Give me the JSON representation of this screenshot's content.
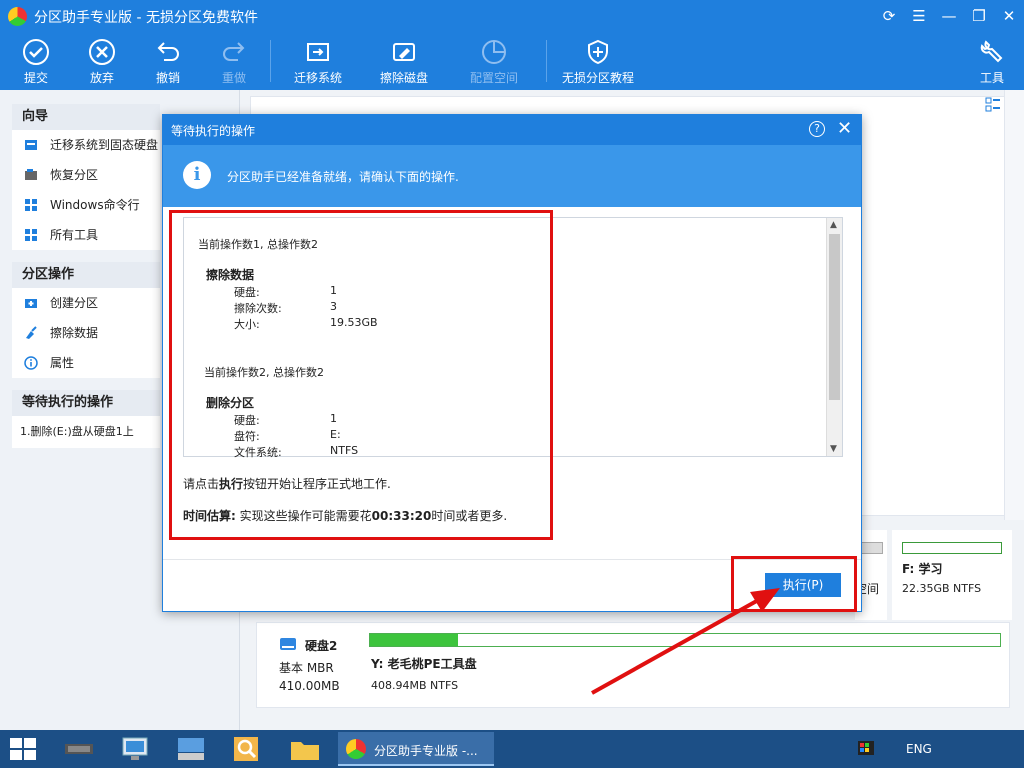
{
  "window": {
    "title": "分区助手专业版 - 无损分区免费软件"
  },
  "toolbar": {
    "commit": "提交",
    "discard": "放弃",
    "undo": "撤销",
    "redo": "重做",
    "migrate": "迁移系统",
    "wipe": "擦除磁盘",
    "config": "配置空间",
    "tutorial": "无损分区教程",
    "tools": "工具"
  },
  "sidebar": {
    "wizard": {
      "title": "向导",
      "items": [
        "迁移系统到固态硬盘",
        "恢复分区",
        "Windows命令行",
        "所有工具"
      ]
    },
    "partition_ops": {
      "title": "分区操作",
      "items": [
        "创建分区",
        "擦除数据",
        "属性"
      ]
    },
    "pending": {
      "title": "等待执行的操作",
      "item": "1.删除(E:)盘从硬盘1上"
    }
  },
  "dialog": {
    "title": "等待执行的操作",
    "help": "?",
    "info_message": "分区助手已经准备就绪，请确认下面的操作.",
    "op1": {
      "header": "当前操作数1, 总操作数2",
      "name": "擦除数据",
      "rows": [
        [
          "硬盘:",
          "1"
        ],
        [
          "擦除次数:",
          "3"
        ],
        [
          "大小:",
          "19.53GB"
        ]
      ]
    },
    "op2": {
      "header": "当前操作数2, 总操作数2",
      "name": "删除分区",
      "rows": [
        [
          "硬盘:",
          "1"
        ],
        [
          "盘符:",
          "E:"
        ],
        [
          "文件系统:",
          "NTFS"
        ]
      ]
    },
    "note_pre": "请点击",
    "note_bold": "执行",
    "note_post": "按钮开始让程序正式地工作.",
    "estimate_label": "时间估算:",
    "estimate_pre": " 实现这些操作可能需要花",
    "estimate_time": "00:33:20",
    "estimate_post": "时间或者更多.",
    "execute_button": "执行(P)"
  },
  "disk_map": {
    "partial_label": "空间",
    "partition_f": {
      "name": "F: 学习",
      "info": "22.35GB NTFS"
    },
    "disk2": {
      "name": "硬盘2",
      "type": "基本 MBR",
      "size": "410.00MB",
      "partition_name": "Y: 老毛桃PE工具盘",
      "partition_info": "408.94MB NTFS",
      "used_fraction": 0.14
    }
  },
  "taskbar": {
    "active_app": "分区助手专业版 -...",
    "lang": "ENG"
  },
  "colors": {
    "accent": "#1f7fdd",
    "annotation": "#e01010",
    "partition_bar": "#3dc43d"
  }
}
